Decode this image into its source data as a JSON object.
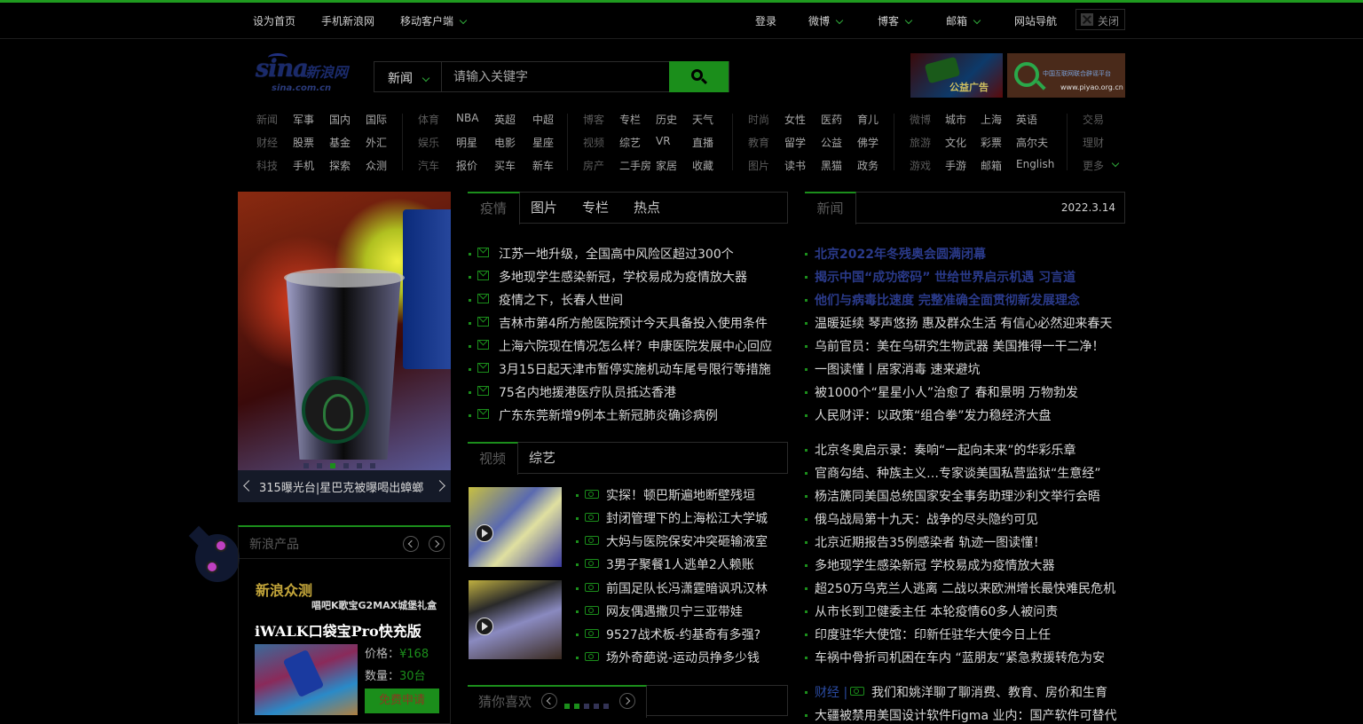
{
  "topbar": {
    "left": [
      "设为首页",
      "手机新浪网",
      "移动客户端"
    ],
    "right": [
      "登录",
      "微博",
      "博客",
      "邮箱",
      "网站导航"
    ],
    "close": "关闭"
  },
  "logo": {
    "brand": "sina",
    "cn": "新浪网",
    "domain": "sina.com.cn"
  },
  "search": {
    "category": "新闻",
    "placeholder": "请输入关键字"
  },
  "ads": {
    "ad1": "公益广告",
    "ad2_title": "中国互联网联合辟谣平台",
    "ad2_link": "www.piyao.org.cn"
  },
  "nav": [
    [
      [
        "新闻",
        "军事",
        "国内",
        "国际"
      ],
      [
        "财经",
        "股票",
        "基金",
        "外汇"
      ],
      [
        "科技",
        "手机",
        "探索",
        "众测"
      ]
    ],
    [
      [
        "体育",
        "NBA",
        "英超",
        "中超"
      ],
      [
        "娱乐",
        "明星",
        "电影",
        "星座"
      ],
      [
        "汽车",
        "报价",
        "买车",
        "新车"
      ]
    ],
    [
      [
        "博客",
        "专栏",
        "历史",
        "天气"
      ],
      [
        "视频",
        "综艺",
        "VR",
        "直播"
      ],
      [
        "房产",
        "二手房",
        "家居",
        "收藏"
      ]
    ],
    [
      [
        "时尚",
        "女性",
        "医药",
        "育儿"
      ],
      [
        "教育",
        "留学",
        "公益",
        "佛学"
      ],
      [
        "图片",
        "读书",
        "黑猫",
        "政务"
      ]
    ],
    [
      [
        "微博",
        "城市",
        "上海",
        "英语"
      ],
      [
        "旅游",
        "文化",
        "彩票",
        "高尔夫"
      ],
      [
        "游戏",
        "手游",
        "邮箱",
        "English"
      ]
    ],
    [
      [
        "交易"
      ],
      [
        "理财"
      ],
      [
        "更多"
      ]
    ]
  ],
  "focus": {
    "caption": "315曝光台|星巴克被曝喝出蟑螂"
  },
  "products": {
    "title": "新浪产品",
    "brand": "新浪众测",
    "subtitle": "唱吧K歌宝G2MAX城堡礼盒",
    "name": "iWALK口袋宝Pro快充版",
    "price_label": "价格：",
    "price": "¥168",
    "qty_label": "数量：",
    "qty": "30台",
    "apply": "免费申请"
  },
  "center": {
    "tabs": [
      "疫情",
      "图片",
      "专栏",
      "热点"
    ],
    "news": [
      "江苏一地升级，全国高中风险区超过300个",
      "多地现学生感染新冠，学校易成为疫情放大器",
      "疫情之下，长春人世间",
      "吉林市第4所方舱医院预计今天具备投入使用条件",
      "上海六院现在情况怎么样？申康医院发展中心回应",
      "3月15日起天津市暂停实施机动车尾号限行等措施",
      "75名内地援港医疗队员抵达香港",
      "广东东莞新增9例本土新冠肺炎确诊病例"
    ],
    "video_tabs": [
      "视频",
      "综艺"
    ],
    "videos1": [
      "实探！顿巴斯遍地断壁残垣",
      "封闭管理下的上海松江大学城",
      "大妈与医院保安冲突砸输液室",
      "3男子聚餐1人逃单2人赖账"
    ],
    "videos2": [
      "前国足队长冯潇霆暗讽巩汉林",
      "网友偶遇撒贝宁三亚带娃",
      "9527战术板-约基奇有多强?",
      "场外奇葩说-运动员挣多少钱"
    ],
    "like_title": "猜你喜欢"
  },
  "right": {
    "tab": "新闻",
    "date": "2022.3.14",
    "headlines": [
      "北京2022年冬残奥会圆满闭幕",
      "揭示中国“成功密码” 世给世界启示机遇 习言道",
      "他们与病毒比速度 完整准确全面贯彻新发展理念"
    ],
    "group1": [
      "温暖延续 琴声悠扬 惠及群众生活 有信心必然迎来春天",
      "乌前官员：美在乌研究生物武器 美国推得一干二净！",
      "一图读懂丨居家消毒 速来避坑",
      "被1000个“星星小人”治愈了 春和景明 万物勃发",
      "人民财评：以政策“组合拳”发力稳经济大盘"
    ],
    "group2": [
      "北京冬奥启示录：奏响“一起向未来”的华彩乐章",
      "官商勾结、种族主义…专家谈美国私营监狱“生意经”",
      "杨洁篪同美国总统国家安全事务助理沙利文举行会晤",
      "俄乌战局第十九天：战争的尽头隐约可见",
      "北京近期报告35例感染者 轨迹一图读懂！",
      "多地现学生感染新冠 学校易成为疫情放大器",
      "超250万乌克兰人逃离 二战以来欧洲增长最快难民危机",
      "从市长到卫健委主任 本轮疫情60多人被问责",
      "印度驻华大使馆：印新任驻华大使今日上任",
      "车祸中骨折司机困在车内 “蓝朋友”紧急救援转危为安"
    ],
    "finance_label": "财经 |",
    "finance": "我们和姚洋聊了聊消费、教育、房价和生育",
    "last": "大疆被禁用美国设计软件Figma 业内：国产软件可替代"
  }
}
